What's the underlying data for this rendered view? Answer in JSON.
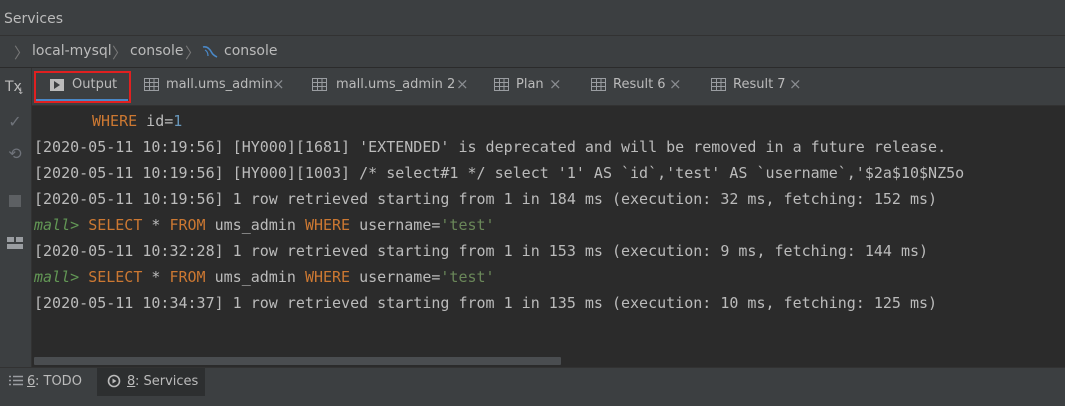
{
  "window": {
    "title": "Services"
  },
  "breadcrumb": {
    "items": [
      "local-mysql",
      "console",
      "console"
    ]
  },
  "tool_strip": {
    "tx_label": "Tx",
    "tx_sub": "↓"
  },
  "tabs": [
    {
      "label": "Output",
      "active": true
    },
    {
      "label": "mall.ums_admin"
    },
    {
      "label": "mall.ums_admin 2"
    },
    {
      "label": "Plan"
    },
    {
      "label": "Result 6"
    },
    {
      "label": "Result 7"
    }
  ],
  "console": {
    "l0_kw": "WHERE",
    "l0_text": " id=",
    "l0_num": "1",
    "l1": "[2020-05-11 10:19:56] [HY000][1681] 'EXTENDED' is deprecated and will be removed in a future release.",
    "l2": "[2020-05-11 10:19:56] [HY000][1003] /* select#1 */ select '1' AS `id`,'test' AS `username`,'$2a$10$NZ5o",
    "l3": "[2020-05-11 10:19:56] 1 row retrieved starting from 1 in 184 ms (execution: 32 ms, fetching: 152 ms)",
    "q1": {
      "prompt": "mall>",
      "select": "SELECT",
      "star": " * ",
      "from": "FROM",
      "table": " ums_admin ",
      "where": "WHERE",
      "cond": " username=",
      "str": "'test'"
    },
    "l5": "[2020-05-11 10:32:28] 1 row retrieved starting from 1 in 153 ms (execution: 9 ms, fetching: 144 ms)",
    "q2": {
      "prompt": "mall>",
      "select": "SELECT",
      "star": " * ",
      "from": "FROM",
      "table": " ums_admin ",
      "where": "WHERE",
      "cond": " username=",
      "str": "'test'"
    },
    "l7": "[2020-05-11 10:34:37] 1 row retrieved starting from 1 in 135 ms (execution: 10 ms, fetching: 125 ms)"
  },
  "bottom": {
    "todo": {
      "num": "6",
      "label": ": TODO"
    },
    "services": {
      "num": "8",
      "label": ": Services"
    }
  },
  "colors": {
    "keyword": "#cc7832",
    "string": "#6a8759",
    "number": "#6897bb",
    "prompt": "#629755",
    "tab_underline": "#4a88c7",
    "highlight": "#e02020"
  }
}
